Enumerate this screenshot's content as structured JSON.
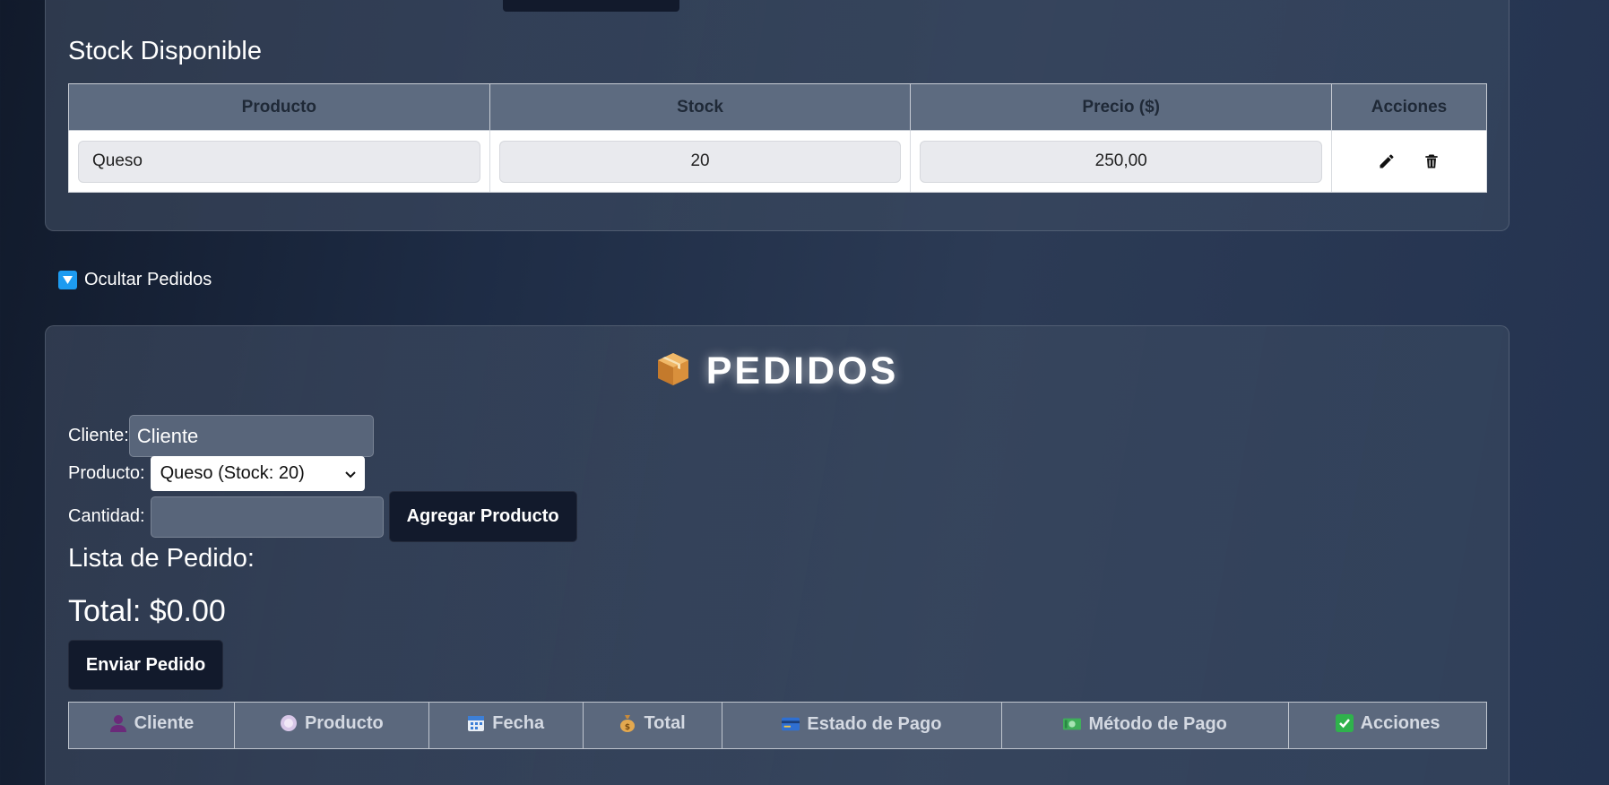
{
  "stock": {
    "title": "Stock Disponible",
    "columns": [
      "Producto",
      "Stock",
      "Precio ($)",
      "Acciones"
    ],
    "rows": [
      {
        "producto": "Queso",
        "stock": "20",
        "precio": "250,00"
      }
    ]
  },
  "toggle": {
    "label": "Ocultar Pedidos"
  },
  "pedidos": {
    "title": "PEDIDOS",
    "cliente_label": "Cliente:",
    "cliente_value": "Cliente",
    "producto_label": "Producto:",
    "producto_selected": "Queso (Stock: 20)",
    "cantidad_label": "Cantidad:",
    "cantidad_value": "",
    "add_button": "Agregar Producto",
    "lista_title": "Lista de Pedido:",
    "total": "Total: $0.00",
    "send_button": "Enviar Pedido",
    "columns": [
      {
        "label": "Cliente",
        "icon": "person-icon"
      },
      {
        "label": "Producto",
        "icon": "product-icon"
      },
      {
        "label": "Fecha",
        "icon": "calendar-icon"
      },
      {
        "label": "Total",
        "icon": "money-bag-icon"
      },
      {
        "label": "Estado de Pago",
        "icon": "credit-card-icon"
      },
      {
        "label": "Método de Pago",
        "icon": "banknote-icon"
      },
      {
        "label": "Acciones",
        "icon": "check-icon"
      }
    ]
  },
  "colors": {
    "accent_blue": "#1d9bf0",
    "dark_button": "#121a2c",
    "table_header": "#5d6b80"
  }
}
